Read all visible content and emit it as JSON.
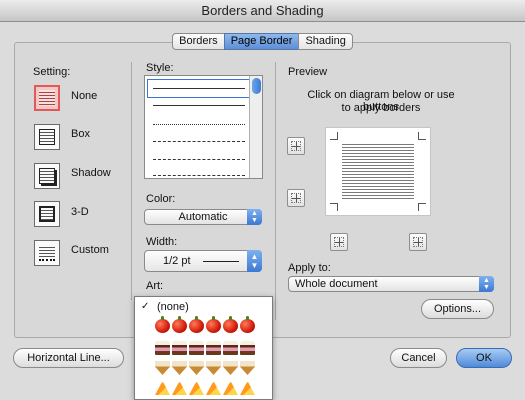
{
  "window": {
    "title": "Borders and Shading"
  },
  "tabs": [
    {
      "label": "Borders"
    },
    {
      "label": "Page Border"
    },
    {
      "label": "Shading"
    }
  ],
  "setting": {
    "heading": "Setting:",
    "items": [
      {
        "label": "None"
      },
      {
        "label": "Box"
      },
      {
        "label": "Shadow"
      },
      {
        "label": "3-D"
      },
      {
        "label": "Custom"
      }
    ]
  },
  "style": {
    "heading": "Style:"
  },
  "color": {
    "heading": "Color:",
    "value": "Automatic"
  },
  "width": {
    "heading": "Width:",
    "value": "1/2 pt"
  },
  "art": {
    "heading": "Art:",
    "selected": "(none)",
    "rows": [
      "apple",
      "cake",
      "cone",
      "candy"
    ]
  },
  "preview": {
    "heading": "Preview",
    "instruction_line1": "Click on diagram below or use buttons",
    "instruction_line2": "to apply borders"
  },
  "apply_to": {
    "heading": "Apply to:",
    "value": "Whole document"
  },
  "buttons": {
    "options": "Options...",
    "horizontal_line": "Horizontal Line...",
    "cancel": "Cancel",
    "ok": "OK"
  },
  "colors": {
    "accent": "#4f8ada",
    "selected_setting": "#e05a5a"
  }
}
